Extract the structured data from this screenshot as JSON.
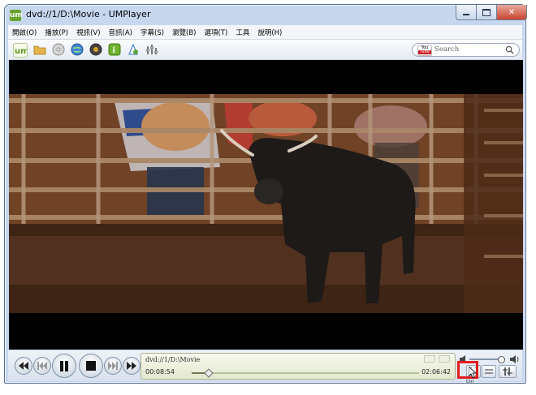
{
  "window": {
    "title": "dvd://1/D:\\Movie - UMPlayer",
    "app_icon_text": "um"
  },
  "menu": {
    "items": [
      "開啟(O)",
      "播放(P)",
      "視訊(V)",
      "音訊(A)",
      "字幕(S)",
      "瀏覽(B)",
      "選項(T)",
      "工具",
      "說明(H)"
    ]
  },
  "toolbar": {
    "icons": [
      "um-logo-icon",
      "open-folder-icon",
      "dvd-disc-icon",
      "url-globe-icon",
      "record-disc-icon",
      "info-icon",
      "audio-icon",
      "equalizer-icon"
    ],
    "search_placeholder": "Search",
    "youtube_top": "You",
    "youtube_bottom": "Tube"
  },
  "player": {
    "file_label": "dvd://1/D:\\Movie",
    "current_time": "00:08:54",
    "total_time": "02:06:42",
    "progress": 0.07,
    "volume": 0.88
  },
  "tooltip": {
    "text": "Ctrl"
  },
  "colors": {
    "accent_red": "#e41d1d",
    "window_frame": "#c6d7ee",
    "close_button": "#c8452f"
  }
}
